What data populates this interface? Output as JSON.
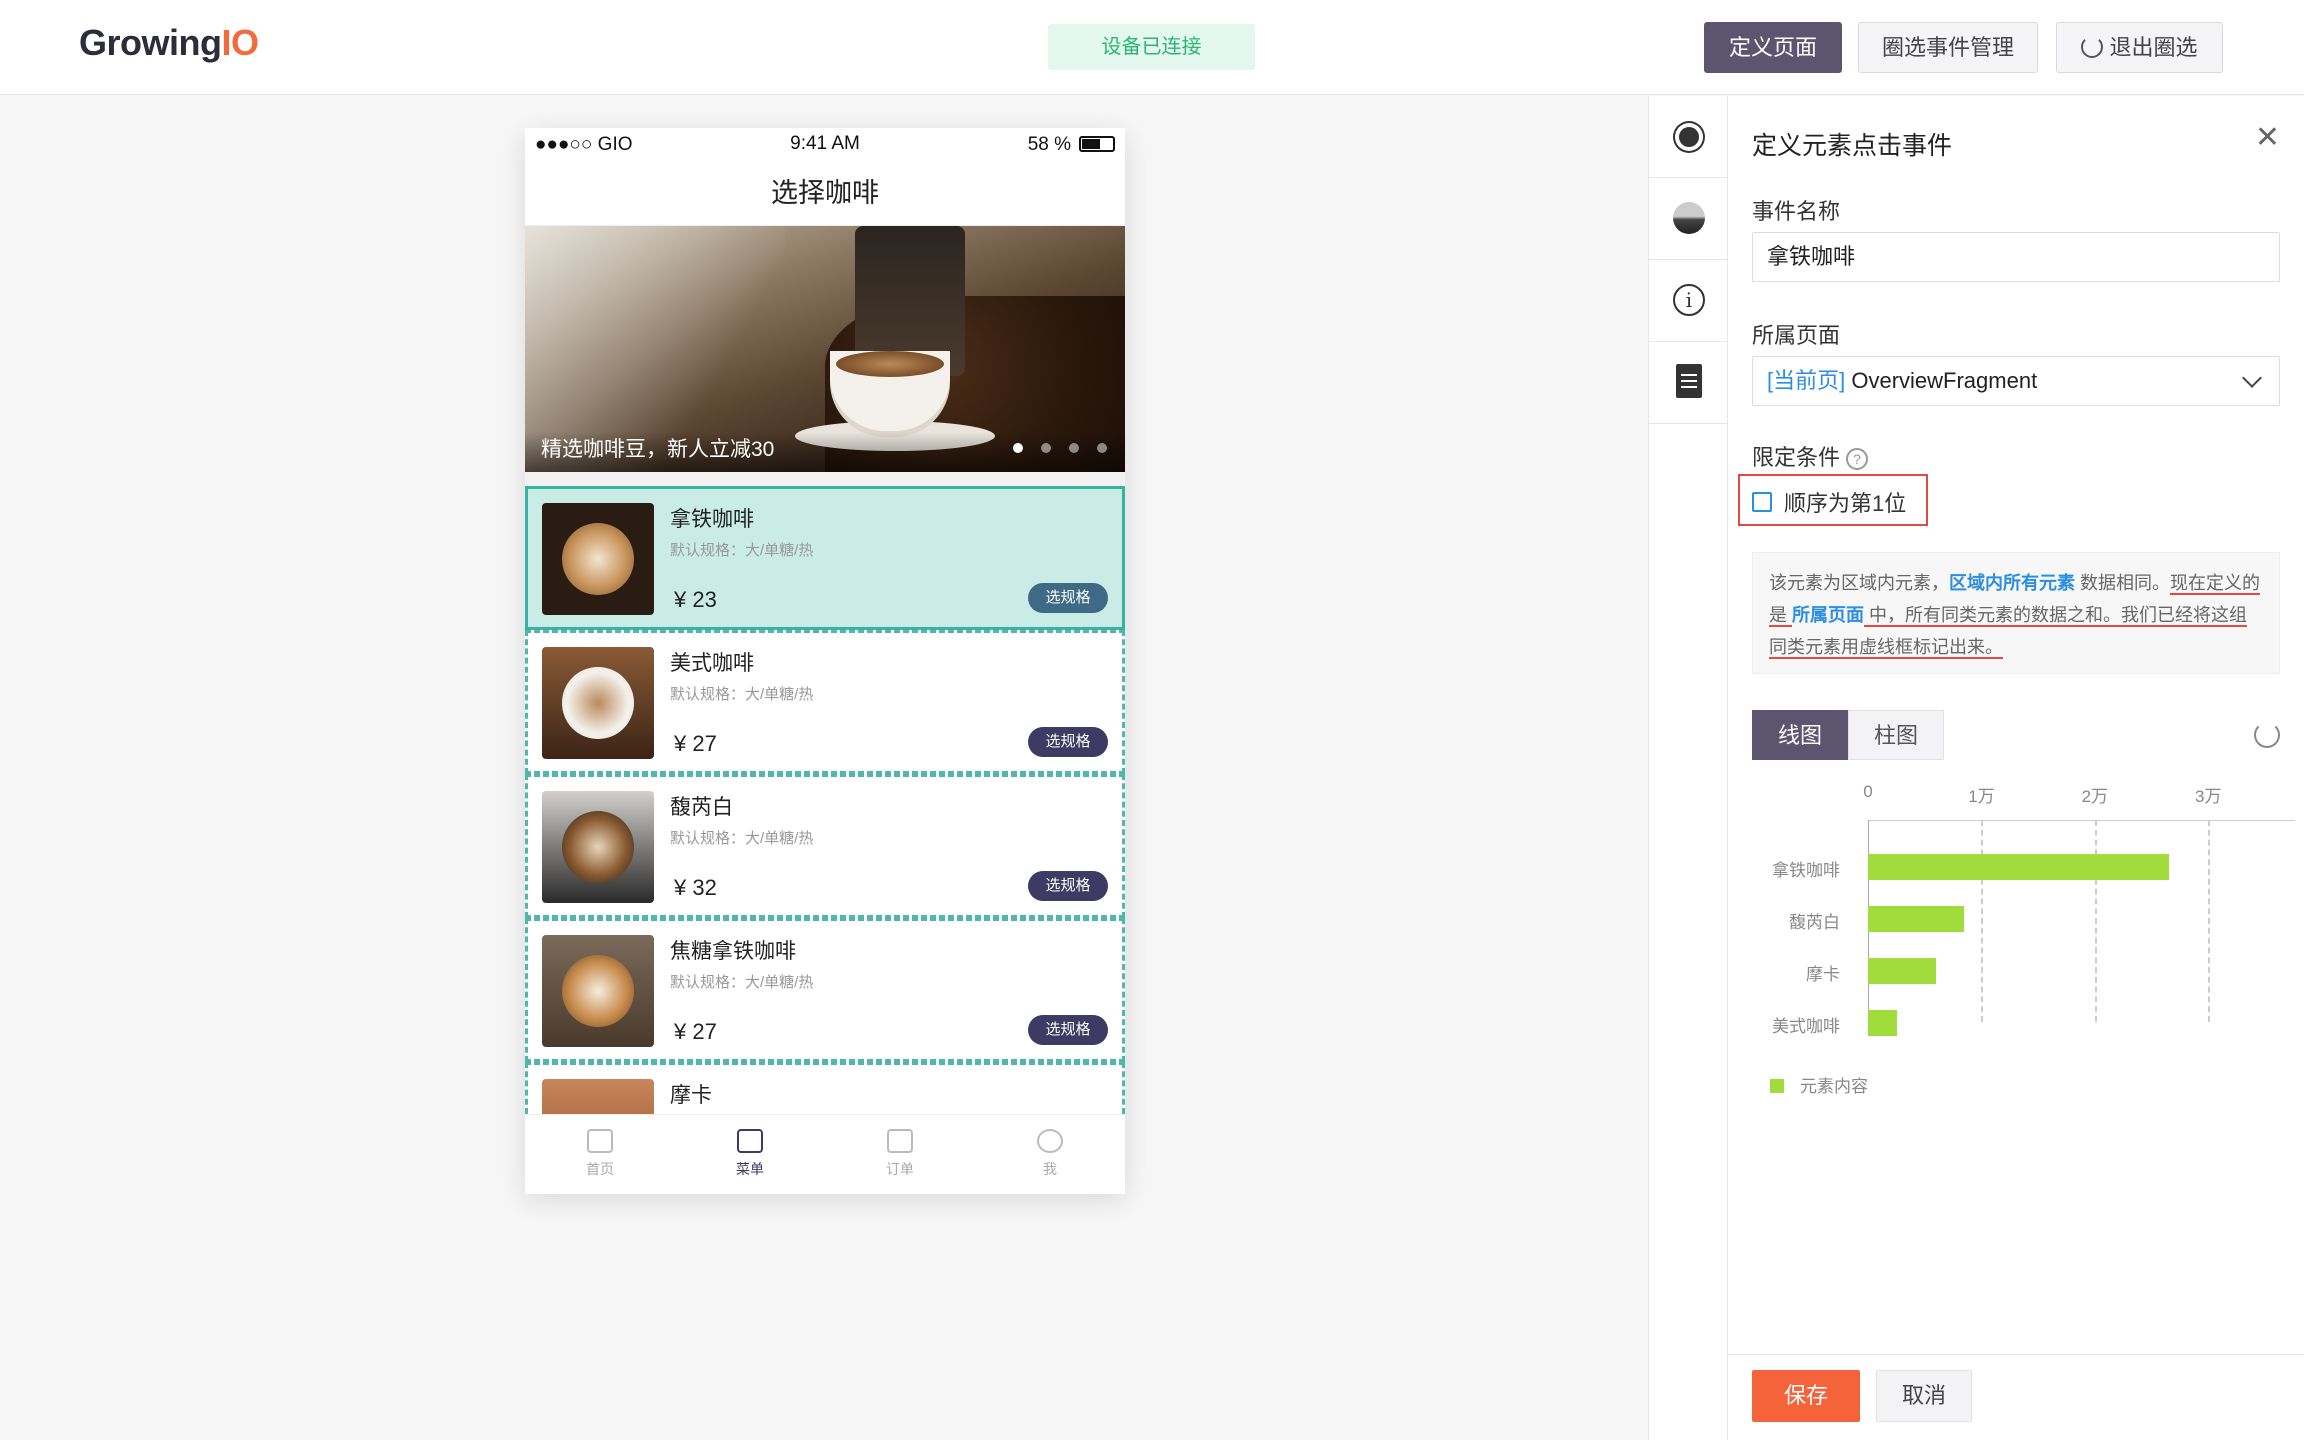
{
  "header": {
    "logo_main": "Growing",
    "logo_accent": "IO",
    "device_status": "设备已连接",
    "btn_define_page": "定义页面",
    "btn_event_manage": "圈选事件管理",
    "btn_exit": "退出圈选"
  },
  "phone": {
    "status_left": "●●●○○ GIO",
    "status_time": "9:41 AM",
    "status_battery": "58 %",
    "title": "选择咖啡",
    "banner_caption": "精选咖啡豆，新人立减30",
    "items": [
      {
        "name": "拿铁咖啡",
        "spec": "默认规格：大/单糖/热",
        "price": "¥ 23",
        "btn": "选规格"
      },
      {
        "name": "美式咖啡",
        "spec": "默认规格：大/单糖/热",
        "price": "¥ 27",
        "btn": "选规格"
      },
      {
        "name": "馥芮白",
        "spec": "默认规格：大/单糖/热",
        "price": "¥ 32",
        "btn": "选规格"
      },
      {
        "name": "焦糖拿铁咖啡",
        "spec": "默认规格：大/单糖/热",
        "price": "¥ 27",
        "btn": "选规格"
      },
      {
        "name": "摩卡"
      }
    ],
    "tabs": [
      "首页",
      "菜单",
      "订单",
      "我"
    ]
  },
  "panel": {
    "title": "定义元素点击事件",
    "event_name_label": "事件名称",
    "event_name_value": "拿铁咖啡",
    "page_label": "所属页面",
    "page_current_tag": "[当前页]",
    "page_value": "OverviewFragment",
    "condition_label": "限定条件",
    "condition_checkbox": "顺序为第1位",
    "note_1": "该元素为区域内元素，",
    "note_link1": "区域内所有元素",
    "note_2": " 数据相同。",
    "note_3": "现在定义的是 ",
    "note_link2": "所属页面",
    "note_4": " 中，所有同类元素的数据之和。我们已经将这组同类元素用虚线框标记出来。",
    "tab_line": "线图",
    "tab_bar": "柱图",
    "legend": "元素内容",
    "save": "保存",
    "cancel": "取消"
  },
  "chart_data": {
    "type": "bar",
    "orientation": "horizontal",
    "categories": [
      "拿铁咖啡",
      "馥芮白",
      "摩卡",
      "美式咖啡"
    ],
    "values": [
      26500,
      8500,
      6000,
      2600
    ],
    "tick_labels": [
      "0",
      "1万",
      "2万",
      "3万"
    ],
    "xlim": [
      0,
      35000
    ],
    "legend": [
      "元素内容"
    ],
    "color": "#a0dc3c"
  }
}
